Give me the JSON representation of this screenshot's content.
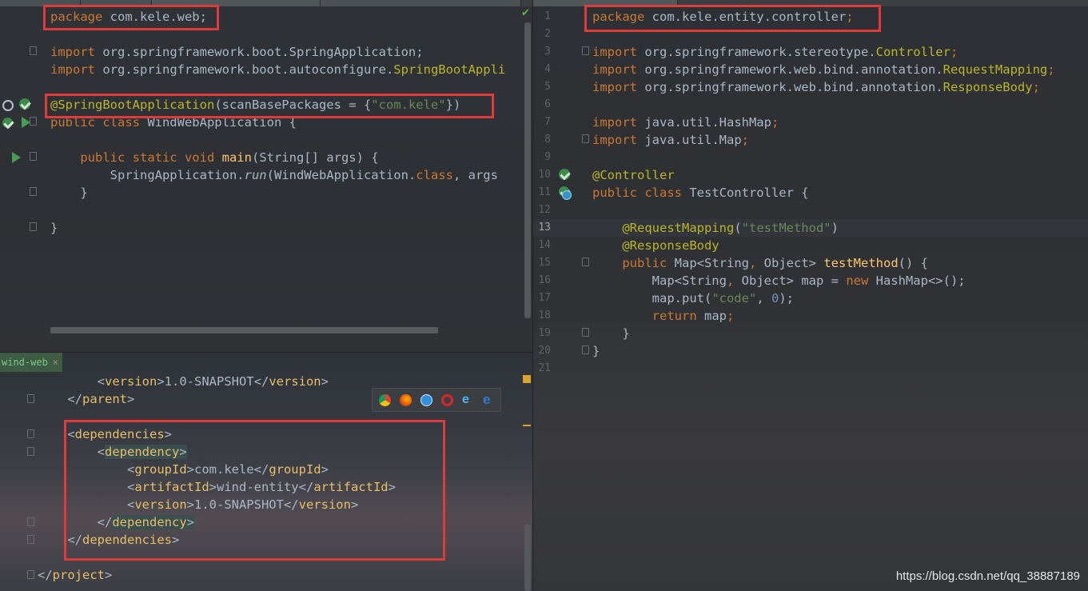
{
  "left_editor": {
    "lines": {
      "l1": [
        "package",
        " com.kele.web;"
      ],
      "l3": [
        "import",
        " org.springframework.boot.SpringApplication;"
      ],
      "l4": [
        "import",
        " org.springframework.boot.autoconfigure.",
        "SpringBootAppli"
      ],
      "l6": [
        "@SpringBootApplication",
        "(scanBasePackages = {",
        "\"com.kele\"",
        "})"
      ],
      "l7": [
        "public class",
        " WindWebApplication {"
      ],
      "l9": [
        "    public static void",
        " main",
        "(String[] args) {"
      ],
      "l10": [
        "        SpringApplication.",
        "run",
        "(WindWebApplication.",
        "class",
        ", args"
      ],
      "l11": [
        "    }"
      ],
      "l13": [
        "}"
      ]
    }
  },
  "pom_editor": {
    "tab_label": "wind-web",
    "tab_close": "×",
    "lines": {
      "p1": [
        "        <",
        "version",
        ">1.0-SNAPSHOT</",
        "version",
        ">"
      ],
      "p2": [
        "    </",
        "parent",
        ">"
      ],
      "p4": [
        "    <",
        "dependencies",
        ">"
      ],
      "p5": [
        "        <",
        "dependency",
        ">"
      ],
      "p6": [
        "            <",
        "groupId",
        ">com.kele</",
        "groupId",
        ">"
      ],
      "p7": [
        "            <",
        "artifactId",
        ">wind-entity</",
        "artifactId",
        ">"
      ],
      "p8": [
        "            <",
        "version",
        ">1.0-SNAPSHOT</",
        "version",
        ">"
      ],
      "p9": [
        "        </",
        "dependency",
        ">"
      ],
      "p10": [
        "    </",
        "dependencies",
        ">"
      ],
      "p12": [
        "</",
        "project",
        ">"
      ]
    }
  },
  "right_editor": {
    "line_numbers": [
      "1",
      "2",
      "3",
      "4",
      "5",
      "6",
      "7",
      "8",
      "9",
      "10",
      "11",
      "12",
      "13",
      "14",
      "15",
      "16",
      "17",
      "18",
      "19",
      "20",
      "21"
    ],
    "lines": {
      "r1": [
        "package",
        " com.kele.entity.controller",
        ";"
      ],
      "r3": [
        "import",
        " org.springframework.stereotype.",
        "Controller",
        ";"
      ],
      "r4": [
        "import",
        " org.springframework.web.bind.annotation.",
        "RequestMapping",
        ";"
      ],
      "r5": [
        "import",
        " org.springframework.web.bind.annotation.",
        "ResponseBody",
        ";"
      ],
      "r7": [
        "import",
        " java.util.HashMap",
        ";"
      ],
      "r8": [
        "import",
        " java.util.Map",
        ";"
      ],
      "r10": [
        "@Controller"
      ],
      "r11": [
        "public class",
        " TestController {"
      ],
      "r13": [
        "    @RequestMapping",
        "(",
        "\"testMethod\"",
        ")"
      ],
      "r14": [
        "    @ResponseBody"
      ],
      "r15": [
        "    public",
        " Map<String",
        ",",
        " Object> ",
        "testMethod",
        "() {"
      ],
      "r16": [
        "        Map<String",
        ",",
        " Object> map = ",
        "new",
        " HashMap<>();"
      ],
      "r17": [
        "        map.put(",
        "\"code\"",
        ", ",
        "0",
        ");"
      ],
      "r18": [
        "        ",
        "return",
        " map",
        ";"
      ],
      "r19": [
        "    }"
      ],
      "r20": [
        "}"
      ]
    }
  },
  "watermark": "https://blog.csdn.net/qq_38887189",
  "check_mark": "✔",
  "colors": {
    "keyword": "#cc7832",
    "annotation": "#bbb529",
    "string": "#6a8759",
    "number": "#6897bb",
    "highlight_box": "#e03b3b"
  },
  "icons": [
    "run-icon",
    "spring-bean-icon",
    "search-icon",
    "chrome-icon",
    "firefox-icon",
    "safari-icon",
    "opera-icon",
    "ie-icon",
    "edge-icon"
  ]
}
